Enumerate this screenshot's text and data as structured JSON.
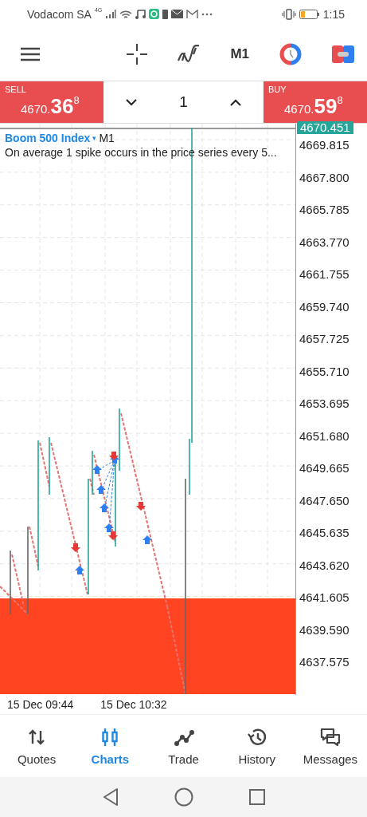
{
  "status_bar": {
    "carrier": "Vodacom SA",
    "network": "4G",
    "time": "1:15"
  },
  "toolbar": {
    "timeframe": "M1"
  },
  "trade_panel": {
    "sell": {
      "label": "SELL",
      "price_main": "4670.",
      "price_big": "36",
      "price_sup": "8"
    },
    "volume": "1",
    "buy": {
      "label": "BUY",
      "price_main": "4670.",
      "price_big": "59",
      "price_sup": "8"
    }
  },
  "chart": {
    "symbol": "Boom 500 Index",
    "symbol_caret": "▾",
    "timeframe": "M1",
    "description": "On average 1 spike occurs in the price series every 5...",
    "current_price": "4670.451",
    "price_labels": [
      "4669.815",
      "4667.800",
      "4665.785",
      "4663.770",
      "4661.755",
      "4659.740",
      "4657.725",
      "4655.710",
      "4653.695",
      "4651.680",
      "4649.665",
      "4647.650",
      "4645.635",
      "4643.620",
      "4641.605",
      "4639.590",
      "4637.575"
    ],
    "time_labels": [
      "15 Dec 09:44",
      "15 Dec 10:32"
    ]
  },
  "bottom_nav": [
    {
      "label": "Quotes",
      "kind": "quotes",
      "selected": false
    },
    {
      "label": "Charts",
      "kind": "charts",
      "selected": true
    },
    {
      "label": "Trade",
      "kind": "trade",
      "selected": false
    },
    {
      "label": "History",
      "kind": "history",
      "selected": false
    },
    {
      "label": "Messages",
      "kind": "messages",
      "selected": false
    }
  ]
}
